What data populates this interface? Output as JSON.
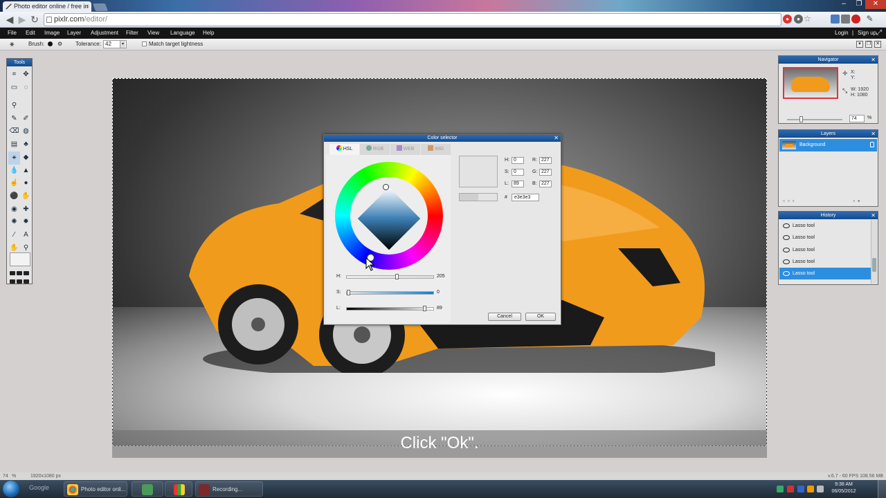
{
  "browser": {
    "tab_title": "Photo editor online / free in",
    "url_host": "pixlr.com",
    "url_path": "/editor/"
  },
  "menu": {
    "items": [
      "File",
      "Edit",
      "Image",
      "Layer",
      "Adjustment",
      "Filter",
      "View",
      "Language",
      "Help"
    ],
    "login": "Login",
    "separator": "|",
    "signup": "Sign up"
  },
  "options": {
    "brush_label": "Brush:",
    "tolerance_label": "Tolerance:",
    "tolerance_value": "42",
    "match_label": "Match target lightness"
  },
  "tools": {
    "title": "Tools"
  },
  "navigator": {
    "title": "Navigator",
    "x_label": "X:",
    "y_label": "Y:",
    "w_label": "W: 1920",
    "h_label": "H: 1080",
    "zoom": "74",
    "zoom_unit": "%"
  },
  "layers": {
    "title": "Layers",
    "items": [
      {
        "name": "Background"
      }
    ]
  },
  "history": {
    "title": "History",
    "items": [
      "Lasso tool",
      "Lasso tool",
      "Lasso tool",
      "Lasso tool",
      "Lasso tool"
    ],
    "active_index": 4
  },
  "color_selector": {
    "title": "Color selector",
    "tabs": [
      "HSL",
      "RGB",
      "WEB",
      "IMG"
    ],
    "active_tab": "HSL",
    "sliders": {
      "h_label": "H:",
      "h_value": "205",
      "s_label": "S:",
      "s_value": "0",
      "l_label": "L:",
      "l_value": "89"
    },
    "fields": {
      "h_label": "H:",
      "h_value": "0",
      "s_label": "S:",
      "s_value": "0",
      "l_label": "L:",
      "l_value": "89",
      "r_label": "R:",
      "r_value": "227",
      "g_label": "G:",
      "g_value": "227",
      "b_label": "B:",
      "b_value": "227"
    },
    "hash_label": "#",
    "hex_value": "e3e3e3",
    "cancel_label": "Cancel",
    "ok_label": "OK",
    "current_color": "#e3e3e3"
  },
  "caption": "Click \"Ok\".",
  "status": {
    "zoom": "74",
    "zoom_unit": "%",
    "dimensions": "1920x1080 px",
    "perf": "v.6.7 - 60 FPS 108.56 MB"
  },
  "taskbar": {
    "google_label": "Google",
    "chrome_item": "Photo editor onli...",
    "recording_item": "Recording...",
    "time": "9:38 AM",
    "date": "06/05/2012"
  },
  "colors": {
    "accent": "#2d8ee0",
    "car": "#f19b1c",
    "panel_header": "#134b8e"
  }
}
